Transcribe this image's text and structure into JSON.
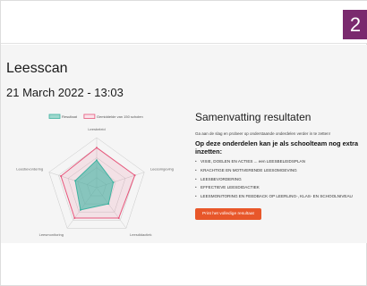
{
  "page_badge": "2",
  "header": {
    "title": "Leesscan",
    "date": "21 March 2022 - 13:03"
  },
  "colors": {
    "badge": "#7a2a6e",
    "result_series": "#3fb3a1",
    "average_series": "#e6557a",
    "print_button": "#e8572a"
  },
  "chart_data": {
    "type": "radar",
    "axes": [
      "Leesbeleid",
      "Leesomgeving",
      "Leesdidactiek",
      "Leesmonitoring",
      "Leesbevordering"
    ],
    "series": [
      {
        "name": "Resultaat",
        "values": [
          0.55,
          0.35,
          0.4,
          0.55,
          0.45
        ]
      },
      {
        "name": "Gemiddelde van 150 scholen",
        "values": [
          0.8,
          0.8,
          0.75,
          0.75,
          0.75
        ]
      }
    ],
    "range": [
      0,
      1
    ],
    "grid_levels": 5,
    "legend": "top"
  },
  "summary": {
    "title": "Samenvatting resultaten",
    "intro": "Ga aan de slag en probeer op onderstaande onderdelen verder in te zetten!",
    "subtitle": "Op deze onderdelen kan je als schoolteam nog extra inzetten:",
    "items": [
      "VISIE, DOELEN EN ACTIES ... een LEESBELEIDSPLAN",
      "KRACHTIGE EN MOTIVERENDE LEESOMGEVING",
      "LEESBEVORDERING",
      "EFFECTIEVE LEESDIDACTIEK",
      "LEESMONITORING EN FEEDBACK OP LEERLING-, KLAS- EN SCHOOLNIVEAU"
    ],
    "print_label": "Print het volledige resultaat"
  }
}
